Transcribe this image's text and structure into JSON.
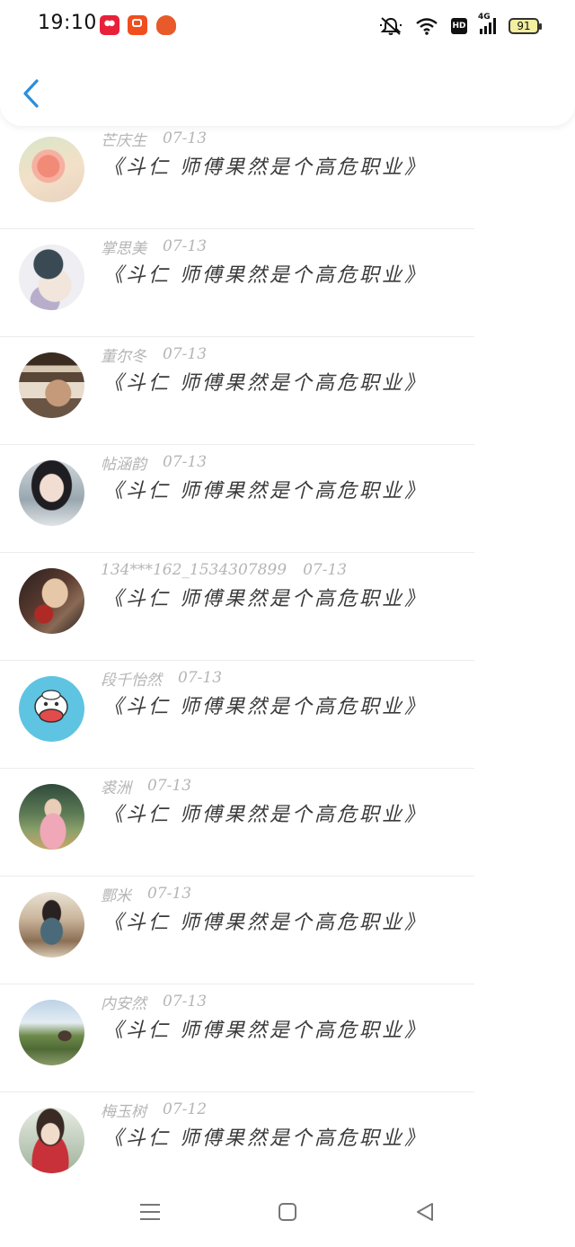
{
  "status_bar": {
    "time": "19:10",
    "battery_level": "91",
    "network_label": "4G",
    "hd_label": "HD",
    "app_icons": [
      "app-icon-red",
      "app-icon-orange",
      "app-icon-pumpkin"
    ]
  },
  "nav": {
    "back_icon": "chevron-left-icon"
  },
  "colors": {
    "accent": "#2a8fdc",
    "meta_text": "#b5b5b5",
    "content_text": "#3a3a3a",
    "divider": "#ececec"
  },
  "comments": [
    {
      "username": "芒庆生",
      "date": "07-13",
      "content": "《斗仁 师傅果然是个高危职业》",
      "avatar": "pink-flower-avatar"
    },
    {
      "username": "掌思美",
      "date": "07-13",
      "content": "《斗仁 师傅果然是个高危职业》",
      "avatar": "anime-beanie-avatar"
    },
    {
      "username": "董尔冬",
      "date": "07-13",
      "content": "《斗仁 师傅果然是个高危职业》",
      "avatar": "reclining-man-avatar"
    },
    {
      "username": "帖涵韵",
      "date": "07-13",
      "content": "《斗仁 师傅果然是个高危职业》",
      "avatar": "girl-portrait-avatar"
    },
    {
      "username": "134***162_1534307899",
      "date": "07-13",
      "content": "《斗仁 师傅果然是个高危职业》",
      "avatar": "anime-dark-avatar"
    },
    {
      "username": "段千怡然",
      "date": "07-13",
      "content": "《斗仁 师傅果然是个高危职业》",
      "avatar": "cartoon-monkey-avatar"
    },
    {
      "username": "裘洲",
      "date": "07-13",
      "content": "《斗仁 师傅果然是个高危职业》",
      "avatar": "girl-outdoor-avatar"
    },
    {
      "username": "酆米",
      "date": "07-13",
      "content": "《斗仁 师傅果然是个高危职业》",
      "avatar": "girl-back-avatar"
    },
    {
      "username": "内安然",
      "date": "07-13",
      "content": "《斗仁 师傅果然是个高危职业》",
      "avatar": "landscape-avatar"
    },
    {
      "username": "梅玉树",
      "date": "07-12",
      "content": "《斗仁 师傅果然是个高危职业》",
      "avatar": "girl-red-sweater-avatar"
    }
  ],
  "bottom_nav": {
    "menu_icon": "menu-icon",
    "home_icon": "home-square-icon",
    "back_icon": "back-triangle-icon"
  }
}
